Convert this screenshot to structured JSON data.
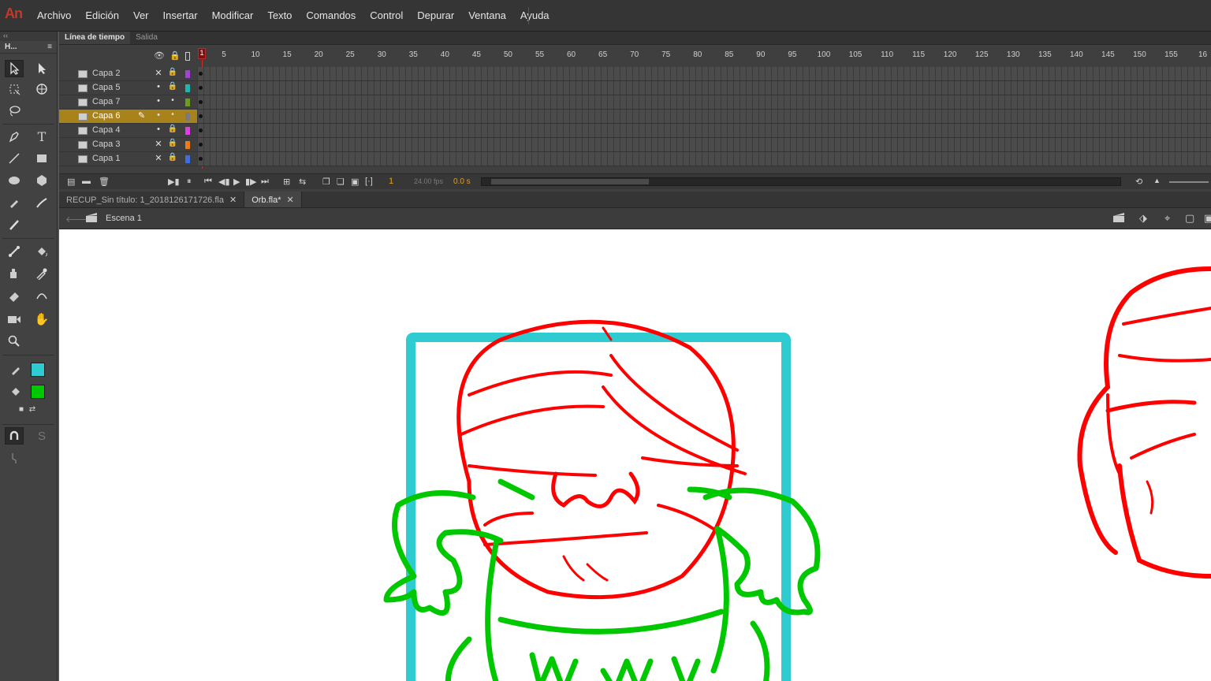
{
  "app": {
    "logo": "An"
  },
  "menu": [
    "Archivo",
    "Edición",
    "Ver",
    "Insertar",
    "Modificar",
    "Texto",
    "Comandos",
    "Control",
    "Depurar",
    "Ventana",
    "Ayuda"
  ],
  "toolbar": {
    "collapse": "‹‹",
    "title": "H..."
  },
  "timeline": {
    "tabs": [
      "Línea de tiempo",
      "Salida"
    ],
    "current_frame": "1",
    "ruler_labels": [
      "5",
      "10",
      "15",
      "20",
      "25",
      "30",
      "35",
      "40",
      "45",
      "50",
      "55",
      "60",
      "65",
      "70",
      "75",
      "80",
      "85",
      "90",
      "95",
      "100",
      "105",
      "110",
      "115",
      "120",
      "125",
      "130",
      "135",
      "140",
      "145",
      "150",
      "155",
      "16"
    ],
    "layers": [
      {
        "name": "Capa 2",
        "visible": "hidden",
        "color": "#a442d8",
        "active": false
      },
      {
        "name": "Capa 5",
        "visible": "shown",
        "color": "#1fb5b0",
        "active": false
      },
      {
        "name": "Capa 7",
        "visible": "shown",
        "color": "#6b9e1a",
        "active": false
      },
      {
        "name": "Capa 6",
        "visible": "shown",
        "color": "#7a7a7a",
        "active": true
      },
      {
        "name": "Capa 4",
        "visible": "shown",
        "color": "#e03ee0",
        "active": false
      },
      {
        "name": "Capa 3",
        "visible": "hidden",
        "color": "#f07a16",
        "active": false
      },
      {
        "name": "Capa 1",
        "visible": "hidden",
        "color": "#3f6ee0",
        "active": false
      }
    ],
    "controls": {
      "frame": "1",
      "fps": "24.00 fps",
      "time": "0.0 s"
    }
  },
  "documents": [
    {
      "name": "RECUP_Sin título: 1_2018126171726.fla",
      "active": false
    },
    {
      "name": "Orb.fla*",
      "active": true
    }
  ],
  "scene": {
    "label": "Escena 1"
  },
  "colors": {
    "stroke": "#2ecbd0",
    "fill": "#00c800",
    "accent": "#a8821a"
  }
}
